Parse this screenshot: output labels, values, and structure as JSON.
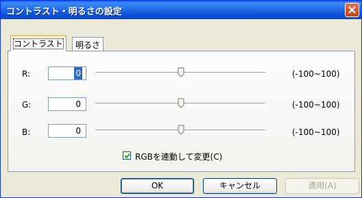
{
  "window": {
    "title": "コントラスト・明るさの設定"
  },
  "tabs": [
    {
      "label": "コントラスト",
      "active": true
    },
    {
      "label": "明るさ",
      "active": false
    }
  ],
  "channels": [
    {
      "label": "R:",
      "value": "0",
      "slider_fraction": 0.5,
      "range": "(-100~100)"
    },
    {
      "label": "G:",
      "value": "0",
      "slider_fraction": 0.5,
      "range": "(-100~100)"
    },
    {
      "label": "B:",
      "value": "0",
      "slider_fraction": 0.5,
      "range": "(-100~100)"
    }
  ],
  "link_checkbox": {
    "label": "RGBを連動して変更(C)",
    "checked": true
  },
  "buttons": {
    "ok": "OK",
    "cancel": "キャンセル",
    "apply": "適用(A)"
  },
  "colors": {
    "titlebar": "#0A53D9",
    "close_button": "#C4401C",
    "selection": "#316AC5",
    "dialog_background": "#ECE9D8",
    "active_tab_highlight": "#FFC73C"
  },
  "icons": {
    "close": "close-x-icon",
    "checkmark": "checkmark-icon",
    "slider_thumb": "slider-thumb-icon"
  }
}
